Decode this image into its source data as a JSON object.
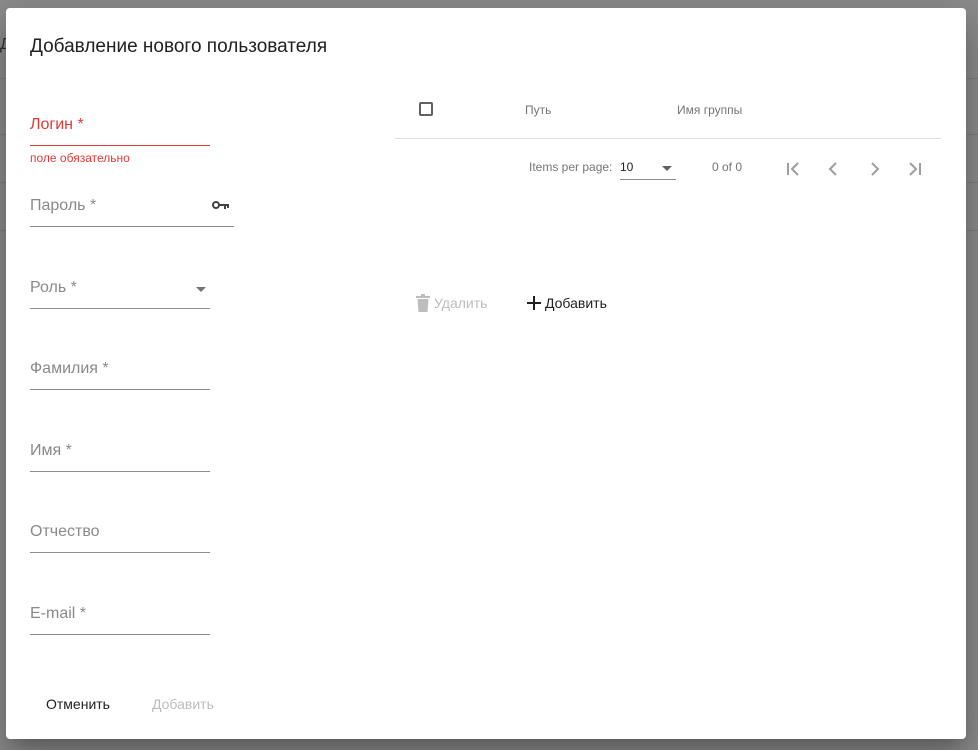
{
  "background": {
    "letter": "Д"
  },
  "dialog": {
    "title": "Добавление нового пользователя",
    "fields": {
      "login": {
        "label": "Логин *",
        "error": "поле обязательно"
      },
      "password": {
        "label": "Пароль *",
        "icon": "key-icon"
      },
      "role": {
        "label": "Роль *",
        "icon": "chevron-down-icon"
      },
      "last_name": {
        "label": "Фамилия *"
      },
      "first_name": {
        "label": "Имя *"
      },
      "middle_name": {
        "label": "Отчество"
      },
      "email": {
        "label": "E-mail *"
      }
    },
    "table": {
      "columns": [
        "Путь",
        "Имя группы"
      ],
      "rows": [],
      "paginator": {
        "items_per_page_label": "Items per page:",
        "items_per_page_value": "10",
        "range_label": "0 of 0"
      },
      "actions": {
        "delete_label": "Удалить",
        "add_label": "Добавить"
      }
    },
    "footer": {
      "cancel_label": "Отменить",
      "submit_label": "Добавить"
    }
  },
  "colors": {
    "error": "#e53935",
    "disabled": "#bdbdbd",
    "text": "#212121"
  }
}
